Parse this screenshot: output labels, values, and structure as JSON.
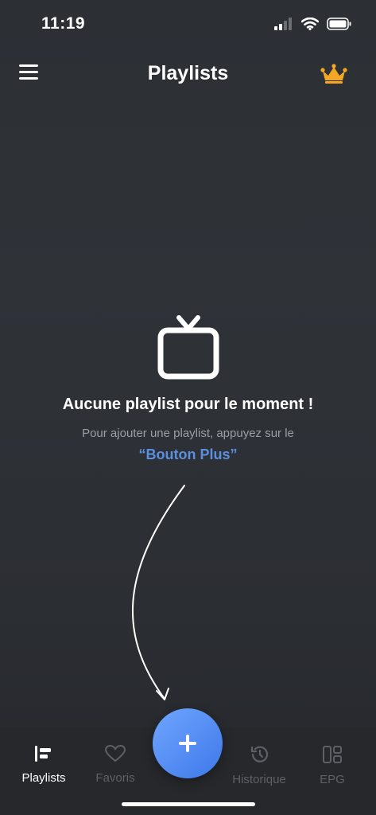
{
  "status_bar": {
    "time": "11:19"
  },
  "header": {
    "title": "Playlists",
    "menu_icon": "hamburger-menu-icon",
    "premium_icon": "crown-icon",
    "premium_color": "#f5a623"
  },
  "empty_state": {
    "icon": "tv-icon",
    "title": "Aucune playlist pour le moment !",
    "subtitle": "Pour ajouter une playlist, appuyez sur le",
    "link_text": "“Bouton Plus”",
    "link_color": "#5b8fe0"
  },
  "tab_bar": {
    "tabs": [
      {
        "label": "Playlists",
        "icon": "playlists-icon",
        "active": true
      },
      {
        "label": "Favoris",
        "icon": "heart-icon",
        "active": false
      },
      {
        "label": "Historique",
        "icon": "history-icon",
        "active": false
      },
      {
        "label": "EPG",
        "icon": "grid-icon",
        "active": false
      }
    ],
    "add_button_icon": "plus-icon",
    "add_button_color": "#4f86f0"
  }
}
